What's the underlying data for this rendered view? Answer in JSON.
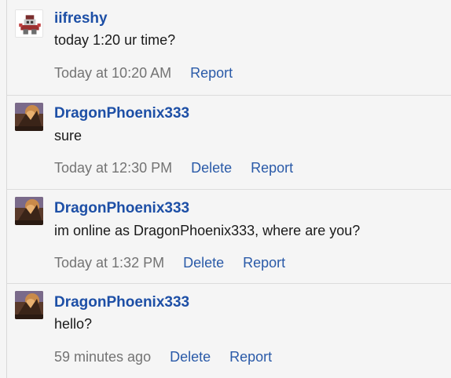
{
  "messages": [
    {
      "username": "iifreshy",
      "avatar_icon": "character-sprite-icon",
      "text": "today 1:20 ur time?",
      "time": "Today at 10:20 AM",
      "actions": [
        "Report"
      ]
    },
    {
      "username": "DragonPhoenix333",
      "avatar_icon": "dragon-artwork-icon",
      "text": "sure",
      "time": "Today at 12:30 PM",
      "actions": [
        "Delete",
        "Report"
      ]
    },
    {
      "username": "DragonPhoenix333",
      "avatar_icon": "dragon-artwork-icon",
      "text": "im online as DragonPhoenix333, where are you?",
      "time": "Today at 1:32 PM",
      "actions": [
        "Delete",
        "Report"
      ]
    },
    {
      "username": "DragonPhoenix333",
      "avatar_icon": "dragon-artwork-icon",
      "text": "hello?",
      "time": "59 minutes ago",
      "actions": [
        "Delete",
        "Report"
      ]
    }
  ],
  "colors": {
    "username": "#1d4fa6",
    "link": "#2a5aa8",
    "timestamp": "#737373",
    "background": "#f5f5f5"
  }
}
